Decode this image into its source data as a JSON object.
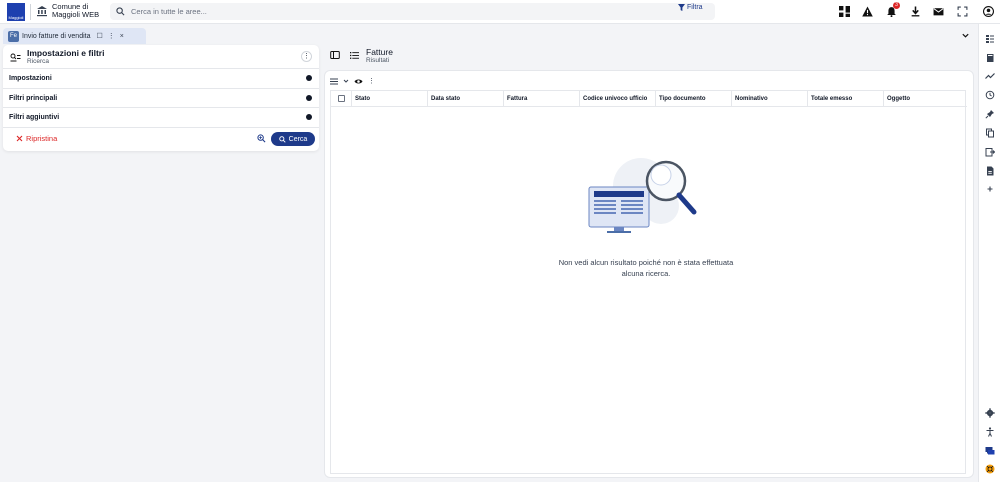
{
  "app": {
    "logo_text": "Maggioli",
    "org_line1": "Comune di",
    "org_line2": "Maggioli WEB"
  },
  "search": {
    "placeholder": "Cerca in tutte le aree...",
    "filter_label": "Filtra"
  },
  "notifications": {
    "count": "3"
  },
  "tab": {
    "badge": "Fe",
    "label": "Invio fatture di vendita",
    "pin_glyph": "☐",
    "menu_glyph": "⋮",
    "close_glyph": "×"
  },
  "left_panel": {
    "title": "Impostazioni e filtri",
    "subtitle": "Ricerca",
    "sections": [
      "Impostazioni",
      "Filtri principali",
      "Filtri aggiuntivi"
    ],
    "reset_label": "Ripristina",
    "search_label": "Cerca"
  },
  "right_panel": {
    "title": "Fatture",
    "subtitle": "Risultati",
    "columns": [
      "Stato",
      "Data stato",
      "Fattura",
      "Codice univoco ufficio",
      "Tipo documento",
      "Nominativo",
      "Totale emesso",
      "Oggetto"
    ],
    "empty_line1": "Non vedi alcun risultato poiché non è stata effettuata",
    "empty_line2": "alcuna ricerca."
  },
  "icons": [
    "bank-icon",
    "search-icon",
    "filter-icon",
    "apps-icon",
    "warning-icon",
    "bell-icon",
    "download-icon",
    "mail-icon",
    "fullscreen-icon",
    "user-icon"
  ],
  "colors": {
    "primary": "#1e3a8a",
    "danger": "#dc2626",
    "tab_bg": "#dfe6f5"
  }
}
